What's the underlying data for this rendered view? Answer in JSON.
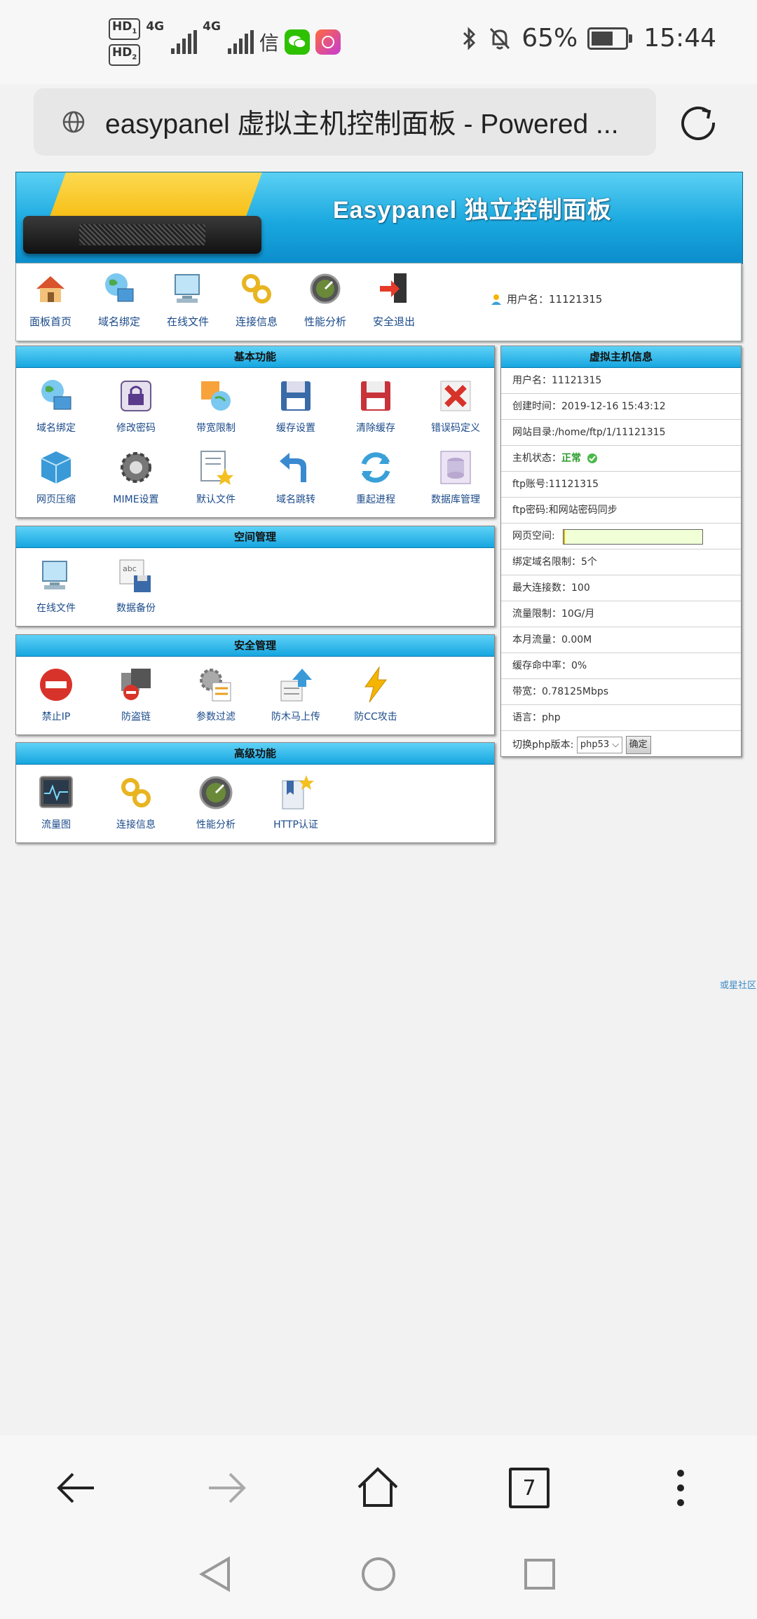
{
  "status_bar": {
    "hd1": "HD",
    "hd1_sub": "1",
    "hd2": "HD",
    "hd2_sub": "2",
    "net1": "4G",
    "net2": "4G",
    "carrier_glyph": "信",
    "battery": "65%",
    "battery_level": 0.65,
    "time": "15:44",
    "icons": [
      "bluetooth-icon",
      "mute-icon",
      "battery-icon",
      "wechat-icon"
    ]
  },
  "browser": {
    "url_title": "easypanel 虚拟主机控制面板 - Powered ...",
    "tab_count": "7"
  },
  "banner": {
    "title": "Easypanel 独立控制面板"
  },
  "top_nav": {
    "items": [
      {
        "label": "面板首页",
        "icon": "house-icon"
      },
      {
        "label": "域名绑定",
        "icon": "globe-icon"
      },
      {
        "label": "在线文件",
        "icon": "computer-icon"
      },
      {
        "label": "连接信息",
        "icon": "link-icon"
      },
      {
        "label": "性能分析",
        "icon": "gauge-icon"
      },
      {
        "label": "安全退出",
        "icon": "exit-icon"
      }
    ],
    "user_label": "用户名：11121315"
  },
  "basic": {
    "title": "基本功能",
    "items": [
      {
        "label": "域名绑定"
      },
      {
        "label": "修改密码"
      },
      {
        "label": "带宽限制"
      },
      {
        "label": "缓存设置"
      },
      {
        "label": "清除缓存"
      },
      {
        "label": "错误码定义"
      },
      {
        "label": "网页压缩"
      },
      {
        "label": "MIME设置"
      },
      {
        "label": "默认文件"
      },
      {
        "label": "域名跳转"
      },
      {
        "label": "重起进程"
      },
      {
        "label": "数据库管理"
      }
    ]
  },
  "space": {
    "title": "空间管理",
    "items": [
      {
        "label": "在线文件"
      },
      {
        "label": "数据备份"
      }
    ]
  },
  "security": {
    "title": "安全管理",
    "items": [
      {
        "label": "禁止IP"
      },
      {
        "label": "防盗链"
      },
      {
        "label": "参数过滤"
      },
      {
        "label": "防木马上传"
      },
      {
        "label": "防CC攻击"
      }
    ]
  },
  "advanced": {
    "title": "高级功能",
    "items": [
      {
        "label": "流量图"
      },
      {
        "label": "连接信息"
      },
      {
        "label": "性能分析"
      },
      {
        "label": "HTTP认证"
      }
    ]
  },
  "info": {
    "title": "虚拟主机信息",
    "username": "用户名：11121315",
    "created": "创建时间：2019-12-16 15:43:12",
    "webroot": "网站目录:/home/ftp/1/11121315",
    "status_label": "主机状态：",
    "status_value": "正常",
    "ftp_account": "ftp账号:11121315",
    "ftp_password": "ftp密码:和网站密码同步",
    "web_space_label": "网页空间:",
    "web_space_used": 0.01,
    "domain_limit": "绑定域名限制：5个",
    "max_conn": "最大连接数：100",
    "traffic_limit": "流量限制：10G/月",
    "month_traffic": "本月流量：0.00M",
    "cache_hit": "缓存命中率：0%",
    "bandwidth": "带宽：0.78125Mbps",
    "language": "语言：php",
    "php_switch_label": "切换php版本:",
    "php_version": "php53",
    "confirm": "确定"
  },
  "footer": {
    "link": "或星社区"
  }
}
